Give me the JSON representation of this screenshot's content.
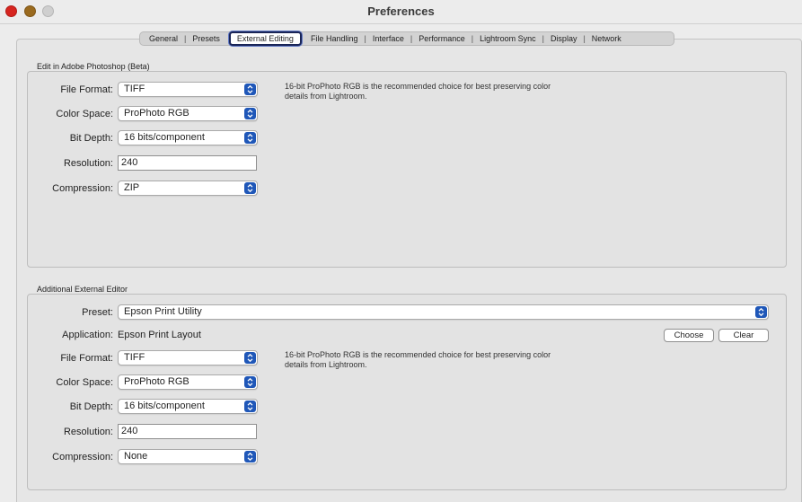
{
  "window": {
    "title": "Preferences"
  },
  "tabs": [
    {
      "label": "General"
    },
    {
      "label": "Presets"
    },
    {
      "label": "External Editing"
    },
    {
      "label": "File Handling"
    },
    {
      "label": "Interface"
    },
    {
      "label": "Performance"
    },
    {
      "label": "Lightroom Sync"
    },
    {
      "label": "Display"
    },
    {
      "label": "Network"
    }
  ],
  "photoshop": {
    "section_title": "Edit in Adobe Photoshop (Beta)",
    "file_format": {
      "label": "File Format:",
      "value": "TIFF"
    },
    "color_space": {
      "label": "Color Space:",
      "value": "ProPhoto RGB"
    },
    "bit_depth": {
      "label": "Bit Depth:",
      "value": "16 bits/component"
    },
    "resolution": {
      "label": "Resolution:",
      "value": "240"
    },
    "compression": {
      "label": "Compression:",
      "value": "ZIP"
    },
    "hint": "16-bit ProPhoto RGB is the recommended choice for best preserving color details from Lightroom."
  },
  "additional": {
    "section_title": "Additional External Editor",
    "preset": {
      "label": "Preset:",
      "value": "Epson Print Utility"
    },
    "application": {
      "label": "Application:",
      "value": "Epson Print Layout"
    },
    "choose_label": "Choose",
    "clear_label": "Clear",
    "file_format": {
      "label": "File Format:",
      "value": "TIFF"
    },
    "color_space": {
      "label": "Color Space:",
      "value": "ProPhoto RGB"
    },
    "bit_depth": {
      "label": "Bit Depth:",
      "value": "16 bits/component"
    },
    "resolution": {
      "label": "Resolution:",
      "value": "240"
    },
    "compression": {
      "label": "Compression:",
      "value": "None"
    },
    "hint": "16-bit ProPhoto RGB is the recommended choice for best preserving color details from Lightroom."
  },
  "colors": {
    "accent": "#1f57b8",
    "close": "#d6251f",
    "minimize": "#9a6a1f"
  }
}
